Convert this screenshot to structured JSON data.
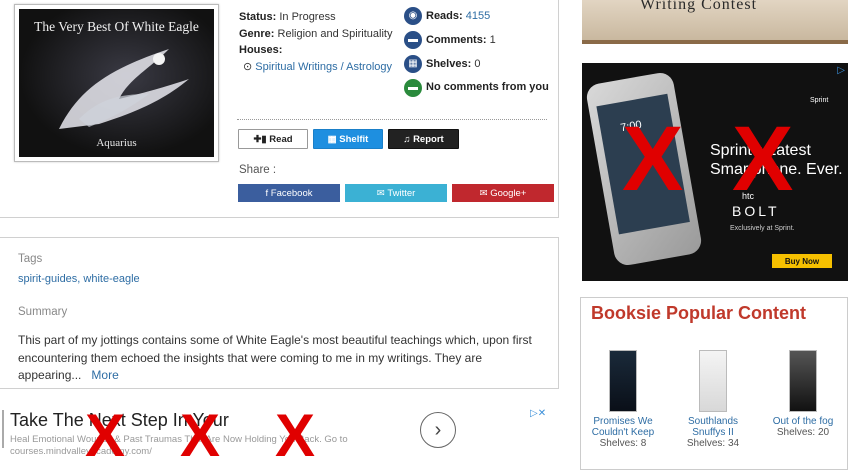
{
  "cover": {
    "title": "The Very Best Of White Eagle",
    "subtitle": "Aquarius"
  },
  "meta": {
    "status_label": "Status:",
    "status_value": "In Progress",
    "genre_label": "Genre:",
    "genre_value": "Religion and Spirituality",
    "houses_label": "Houses:",
    "house_link": "Spiritual Writings / Astrology"
  },
  "stats": {
    "reads_label": "Reads:",
    "reads_value": "4155",
    "comments_label": "Comments:",
    "comments_value": "1",
    "shelves_label": "Shelves:",
    "shelves_value": "0",
    "no_comments": "No comments from you"
  },
  "actions": {
    "read": "Read",
    "shelfit": "Shelfit",
    "report": "Report"
  },
  "share": {
    "label": "Share :",
    "facebook": "Facebook",
    "twitter": "Twitter",
    "googleplus": "Google+"
  },
  "details": {
    "tags_label": "Tags",
    "tags_value": "spirit-guides, white-eagle",
    "summary_label": "Summary",
    "summary_text": "This part of my jottings contains some of White Eagle's most beautiful teachings which, upon first encountering them echoed the insights that were coming to me in my writings. They are appearing...",
    "more": "More"
  },
  "ad_bottom": {
    "title": "Take The Next Step In Your",
    "desc_line1": "Heal Emotional Wounds & Past Traumas That Are Now Holding You Back.",
    "desc_go": "Go to",
    "desc_line2": "courses.mindvalleyacademy.com/",
    "arrow": "›",
    "adchoice": "▷✕"
  },
  "right": {
    "banner_text": "Writing Contest",
    "sprint_logo": "Sprint",
    "sprint_headline_1": "Sprint's Latest",
    "sprint_headline_2": "Smartphone. Ever.",
    "htc": "htc",
    "bolt": "BOLT",
    "bolt_sub": "Exclusively at Sprint.",
    "buy_now": "Buy Now",
    "phone_time": "7:00",
    "adchoice": "▷",
    "popular_title": "Booksie Popular Content",
    "popular": [
      {
        "title": "Promises We Couldn't Keep",
        "shelves": "Shelves: 8"
      },
      {
        "title": "Southlands Snuffys II",
        "shelves": "Shelves: 34"
      },
      {
        "title": "Out of the fog",
        "shelves": "Shelves: 20"
      }
    ]
  },
  "icons": {
    "x_mark": "X",
    "colors": {
      "link": "#2e6da4",
      "facebook": "#3b5e9e",
      "twitter": "#3bb1d4",
      "googleplus": "#c0282e",
      "shelfit": "#1e8fe0",
      "popular": "#c0392b"
    }
  }
}
